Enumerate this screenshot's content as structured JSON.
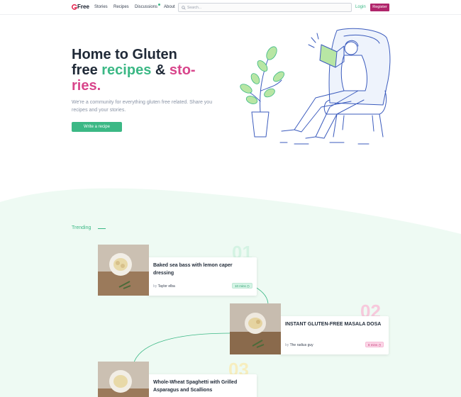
{
  "nav": {
    "logo_text": "Free",
    "links": [
      "Stories",
      "Recipes",
      "Discussions",
      "About"
    ],
    "search_placeholder": "Search...",
    "login": "Login",
    "register": "Register"
  },
  "hero": {
    "title_part1": "Home to Gluten",
    "title_part2": "free",
    "title_recipes": "recipes",
    "title_amp": "&",
    "title_stories1": "sto-",
    "title_stories2": "ries.",
    "subtitle": "We're a community for everything gluten free related. Share you recipes and your stories.",
    "cta": "Write a recipe"
  },
  "trending": {
    "label": "Trending",
    "items": [
      {
        "number": "01",
        "title": "Baked sea bass with lemon caper dressing",
        "by": "by",
        "author": "Taylor elba",
        "tag": "10 mins"
      },
      {
        "number": "02",
        "title": "INSTANT GLUTEN-FREE MASALA DOSA",
        "by": "by",
        "author": "The radius guy",
        "tag": "8 mins"
      },
      {
        "number": "03",
        "title": "Whole-Wheat Spaghetti with Grilled Asparagus and Scallions",
        "by": "by",
        "author": "",
        "tag": ""
      }
    ]
  },
  "colors": {
    "green": "#3bb885",
    "pink": "#d8458b",
    "register": "#b0256b"
  }
}
